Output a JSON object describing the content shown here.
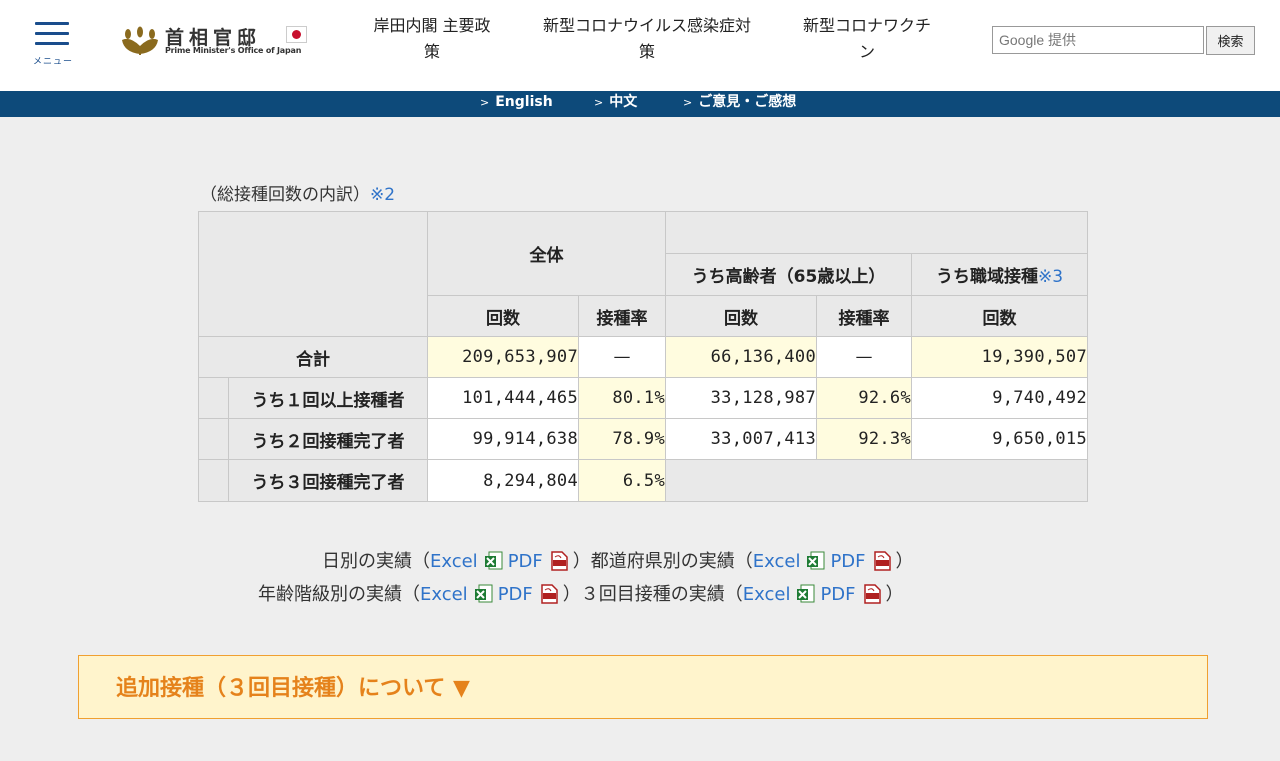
{
  "header": {
    "menu_label": "メニュー",
    "logo_jp": "首相官邸",
    "logo_en": "Prime Minister's Office of Japan",
    "nav": [
      {
        "line1": "岸田内閣 主要政",
        "line2": "策"
      },
      {
        "line1": "新型コロナウイルス感染症対",
        "line2": "策"
      },
      {
        "line1": "新型コロナワクチ",
        "line2": "ン"
      }
    ],
    "search_placeholder": "Google 提供",
    "search_button": "検索"
  },
  "subnav": [
    "English",
    "中文",
    "ご意見・ご感想"
  ],
  "caption": {
    "text": "（総接種回数の内訳）",
    "note": "※2"
  },
  "table": {
    "col_overall": "全体",
    "col_elderly": "うち高齢者（65歳以上）",
    "col_workplace": "うち職域接種",
    "col_workplace_note": "※3",
    "sub_count": "回数",
    "sub_rate": "接種率",
    "rows": [
      {
        "label": "合計",
        "overall_count": "209,653,907",
        "overall_rate": "—",
        "elderly_count": "66,136,400",
        "elderly_rate": "—",
        "workplace_count": "19,390,507"
      },
      {
        "label": "うち１回以上接種者",
        "overall_count": "101,444,465",
        "overall_rate": "80.1%",
        "elderly_count": "33,128,987",
        "elderly_rate": "92.6%",
        "workplace_count": "9,740,492"
      },
      {
        "label": "うち２回接種完了者",
        "overall_count": "99,914,638",
        "overall_rate": "78.9%",
        "elderly_count": "33,007,413",
        "elderly_rate": "92.3%",
        "workplace_count": "9,650,015"
      },
      {
        "label": "うち３回接種完了者",
        "overall_count": "8,294,804",
        "overall_rate": "6.5%"
      }
    ]
  },
  "links": {
    "daily": "日別の実績（",
    "prefecture": "都道府県別の実績（",
    "age": "年齢階級別の実績（",
    "third": "３回目接種の実績（",
    "excel": "Excel",
    "pdf": "PDF",
    "close_paren": "）"
  },
  "accordion": {
    "title": "追加接種（３回目接種）について ▼"
  },
  "colors": {
    "brand_blue": "#0d4a7a",
    "link": "#2f73c9",
    "accent_orange": "#e5821b",
    "highlight_yellow": "#fffcdf"
  }
}
